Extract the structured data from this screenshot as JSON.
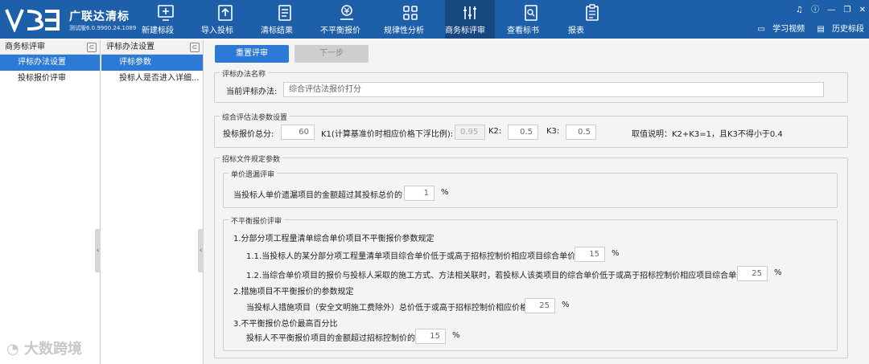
{
  "brand": {
    "name": "广联达清标",
    "version": "测试版6.0.9900.24.1089",
    "logo_text": "V3"
  },
  "nav": [
    {
      "label": "新建标段",
      "icon": "new-bid-icon"
    },
    {
      "label": "导入投标",
      "icon": "import-bid-icon"
    },
    {
      "label": "清标结果",
      "icon": "result-list-icon"
    },
    {
      "label": "不平衡报价",
      "icon": "unbalanced-quote-icon"
    },
    {
      "label": "规律性分析",
      "icon": "pattern-analysis-icon"
    },
    {
      "label": "商务标评审",
      "icon": "business-review-icon",
      "active": true
    },
    {
      "label": "查看标书",
      "icon": "view-doc-icon"
    },
    {
      "label": "报表",
      "icon": "report-icon"
    }
  ],
  "window_controls": [
    "headset",
    "info",
    "minimize",
    "restore",
    "close"
  ],
  "help": {
    "video": "学习视频",
    "history": "历史标段"
  },
  "pane1": {
    "title": "商务标评审",
    "items": [
      "评标办法设置",
      "投标报价评审"
    ]
  },
  "pane2": {
    "title": "评标办法设置",
    "items": [
      "评标参数",
      "投标人是否进入详细..."
    ]
  },
  "toolbar": {
    "reset": "重置评审",
    "next": "下一步"
  },
  "method": {
    "group_title": "评标办法名称",
    "label": "当前评标办法:",
    "value": "综合评估法报价打分"
  },
  "params": {
    "group_title": "综合评估法参数设置",
    "total_label": "投标报价总分:",
    "total_value": "60",
    "k1_label": "K1(计算基准价时相应价格下浮比例):",
    "k1_value": "0.95",
    "k2_label": "K2:",
    "k2_value": "0.5",
    "k3_label": "K3:",
    "k3_value": "0.5",
    "note": "取值说明：K2+K3=1，且K3不得小于0.4"
  },
  "tender": {
    "group_title": "招标文件规定参数",
    "omission": {
      "title": "单价遗漏评审",
      "text": "当投标人单价遗漏项目的金额超过其投标总价的",
      "value": "1",
      "unit": "%"
    },
    "unbalanced": {
      "title": "不平衡报价评审",
      "s1": "1.分部分项工程量清单综合单价项目不平衡报价参数规定",
      "s1_1": "1.1.当投标人的某分部分项工程量清单项目综合单价低于或高于招标控制价相应项目综合单价",
      "s1_1_value": "15",
      "s1_2": "1.2.当综合单价项目的报价与投标人采取的施工方式、方法相关联时，若投标人该类项目的综合单价低于或高于招标控制价相应项目综合单价",
      "s1_2_value": "25",
      "s2": "2.措施项目不平衡报价的参数规定",
      "s2_1": "当投标人措施项目（安全文明施工费除外）总价低于或高于招标控制价相应价格",
      "s2_1_value": "25",
      "s3": "3.不平衡报价总价最高百分比",
      "s3_1": "投标人不平衡报价项目的金额超过招标控制价的",
      "s3_1_value": "15",
      "unit": "%"
    }
  },
  "watermark": "大数跨境"
}
